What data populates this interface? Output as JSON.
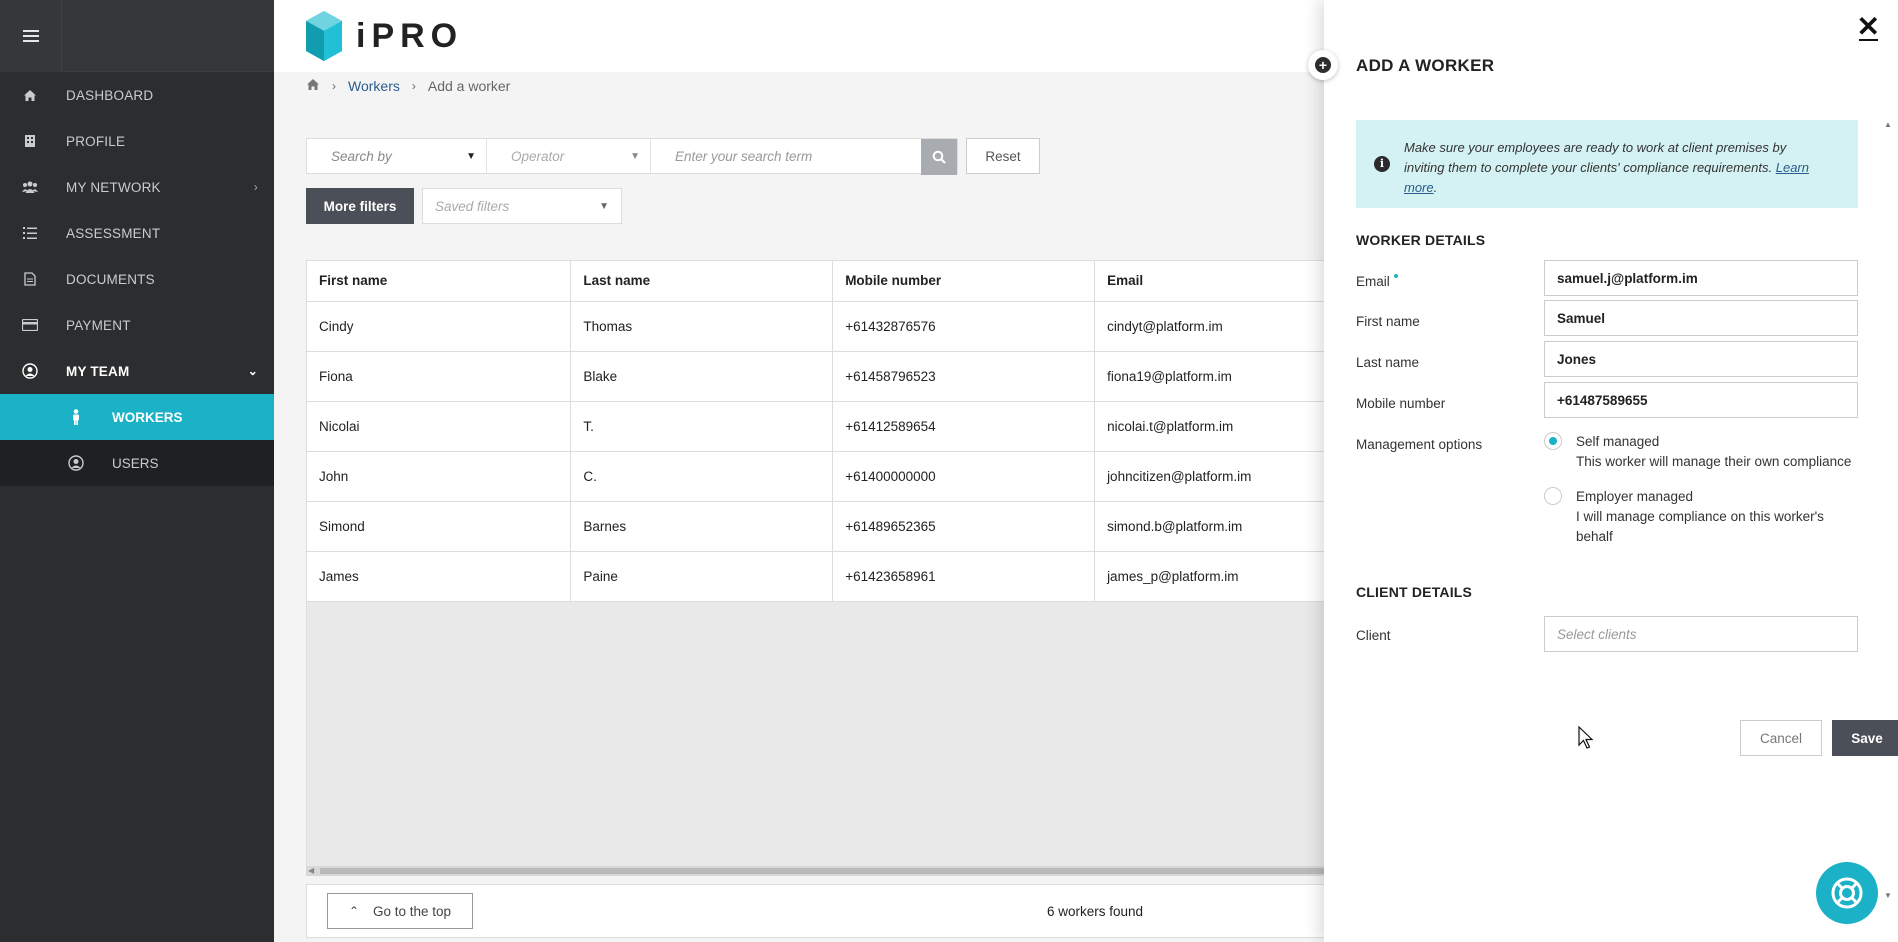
{
  "sidebar": {
    "items": [
      {
        "label": "DASHBOARD",
        "icon": "home-icon"
      },
      {
        "label": "PROFILE",
        "icon": "building-icon"
      },
      {
        "label": "MY NETWORK",
        "icon": "users-icon"
      },
      {
        "label": "ASSESSMENT",
        "icon": "list-icon"
      },
      {
        "label": "DOCUMENTS",
        "icon": "document-icon"
      },
      {
        "label": "PAYMENT",
        "icon": "credit-card-icon"
      },
      {
        "label": "MY TEAM",
        "icon": "user-circle-icon"
      }
    ],
    "sub_items": [
      {
        "label": "WORKERS",
        "icon": "person-icon"
      },
      {
        "label": "USERS",
        "icon": "user-circle-icon"
      }
    ]
  },
  "header": {
    "logo_text": "iPRO"
  },
  "breadcrumb": {
    "workers": "Workers",
    "current": "Add a worker"
  },
  "filters": {
    "search_by": "Search by",
    "operator": "Operator",
    "term_placeholder": "Enter your search term",
    "reset": "Reset",
    "more_filters": "More filters",
    "saved_filters": "Saved filters"
  },
  "table": {
    "headers": [
      "First name",
      "Last name",
      "Mobile number",
      "Email"
    ],
    "rows": [
      [
        "Cindy",
        "Thomas",
        "+61432876576",
        "cindyt@platform.im"
      ],
      [
        "Fiona",
        "Blake",
        "+61458796523",
        "fiona19@platform.im"
      ],
      [
        "Nicolai",
        "T.",
        "+61412589654",
        "nicolai.t@platform.im"
      ],
      [
        "John",
        "C.",
        "+61400000000",
        "johncitizen@platform.im"
      ],
      [
        "Simond",
        "Barnes",
        "+61489652365",
        "simond.b@platform.im"
      ],
      [
        "James",
        "Paine",
        "+61423658961",
        "james_p@platform.im"
      ]
    ]
  },
  "footer": {
    "go_top": "Go to the top",
    "count": "6 workers found"
  },
  "panel": {
    "title": "ADD A WORKER",
    "info_text": "Make sure your employees are ready to work at client premises by inviting them to complete your clients' compliance requirements.",
    "learn_more": "Learn more",
    "worker_details_title": "WORKER DETAILS",
    "fields": {
      "email_label": "Email",
      "email_value": "samuel.j@platform.im",
      "first_name_label": "First name",
      "first_name_value": "Samuel",
      "last_name_label": "Last name",
      "last_name_value": "Jones",
      "mobile_label": "Mobile number",
      "mobile_value": "+61487589655",
      "management_label": "Management options"
    },
    "management_options": [
      {
        "title": "Self managed",
        "desc": "This worker will manage their own compliance",
        "checked": true
      },
      {
        "title": "Employer managed",
        "desc": "I will manage compliance on this worker's behalf",
        "checked": false
      }
    ],
    "client_details_title": "CLIENT DETAILS",
    "client_label": "Client",
    "client_placeholder": "Select clients",
    "cancel": "Cancel",
    "save": "Save"
  },
  "colors": {
    "accent": "#1bb2c8",
    "sidebar_bg": "#2b2d2e",
    "primary_button": "#4b4f57",
    "info_bg": "#d4f1f3"
  }
}
